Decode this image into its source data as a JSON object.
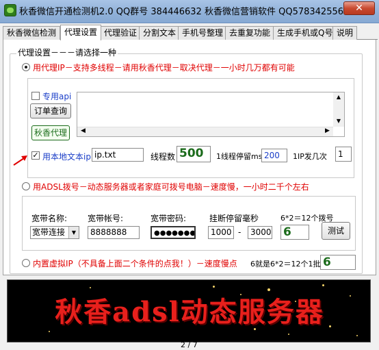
{
  "window": {
    "title": "秋香微信开通检测机2.0 QQ群号 384446632 秋香微信营销软件 QQ578342556",
    "close_label": "✕"
  },
  "tabs": [
    {
      "label": "秋香微信检测"
    },
    {
      "label": "代理设置"
    },
    {
      "label": "代理验证"
    },
    {
      "label": "分割文本"
    },
    {
      "label": "手机号整理"
    },
    {
      "label": "去重复功能"
    },
    {
      "label": "生成手机或Q号"
    },
    {
      "label": "说明"
    }
  ],
  "active_tab": "代理设置",
  "proxy": {
    "group_label": "代理设置－－－请选择一种",
    "option1_label": "用代理IP－支持多线程－请用秋香代理－取决代理－一小时几万都有可能",
    "api_checkbox_label": "专用api",
    "order_query_button": "订单查询",
    "qiuxiang_proxy_button": "秋香代理",
    "local_text_checkbox_label": "用本地文本ip",
    "local_text_file": "ip.txt",
    "threads_label": "线程数",
    "threads_value": "500",
    "thread_wait_label": "1线程停留ms",
    "thread_wait_value": "200",
    "ip_send_label": "1IP发几次",
    "ip_send_value": "1"
  },
  "adsl": {
    "option2_label": "用ADSL拨号－动态服务器或者家庭可拨号电脑－速度慢，一小时二千个左右",
    "name_label": "宽带名称:",
    "name_value": "宽带连接",
    "account_label": "宽带帐号:",
    "account_value": "8888888",
    "password_label": "宽带密码:",
    "password_value": "●●●●●●●",
    "disconnect_label": "挂断停留毫秒",
    "disconnect_min": "1000",
    "disconnect_dash": "-",
    "disconnect_max": "3000",
    "dial_label": "6*2＝12个拨号",
    "dial_value": "6",
    "test_button": "测试"
  },
  "virtual": {
    "option3_label": "内置虚拟IP（不具备上面二个条件的点我！）－速度慢点",
    "batch_label": "6就是6*2＝12个1批",
    "batch_value": "6"
  },
  "banner": {
    "text": "秋香adsl动态服务器"
  },
  "pager": {
    "text": "2 / 7"
  },
  "colors": {
    "accent_red": "#e00000",
    "number_green": "#1b6b1b"
  }
}
